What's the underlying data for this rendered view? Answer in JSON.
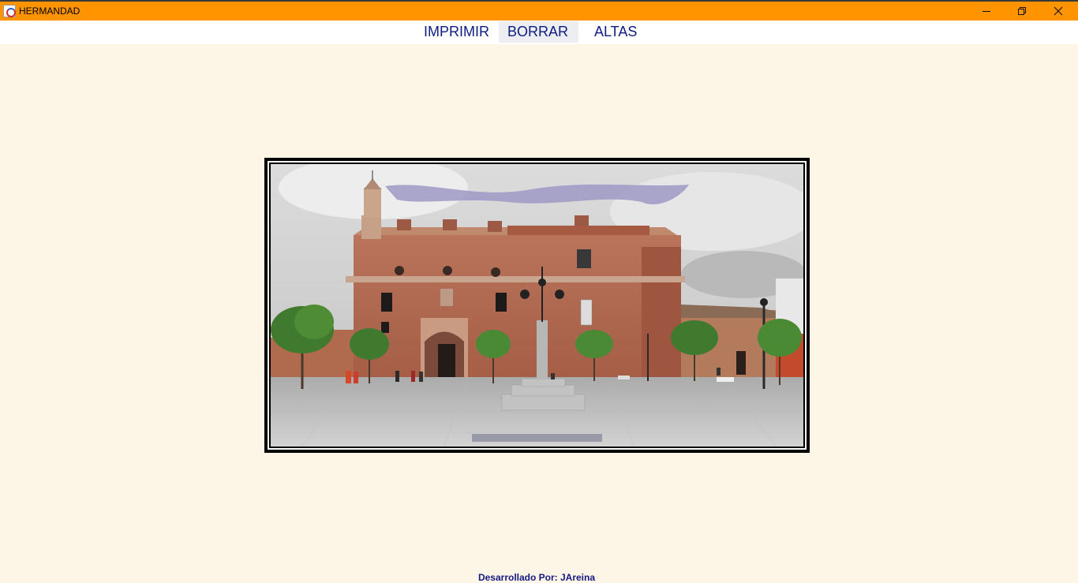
{
  "window": {
    "title": "HERMANDAD",
    "icons": {
      "app": "java-cup-icon",
      "minimize": "minimize-icon",
      "maximize": "restore-icon",
      "close": "close-icon"
    }
  },
  "menu": {
    "items": [
      {
        "label": "IMPRIMIR"
      },
      {
        "label": "BORRAR"
      },
      {
        "label": "ALTAS"
      }
    ]
  },
  "main": {
    "image": "church-plaza-photo"
  },
  "footer": {
    "credit": "Desarrollado Por: JAreina"
  },
  "colors": {
    "titlebar": "#ff9300",
    "background": "#fdf5e6",
    "menu_text": "#0d1d82"
  }
}
